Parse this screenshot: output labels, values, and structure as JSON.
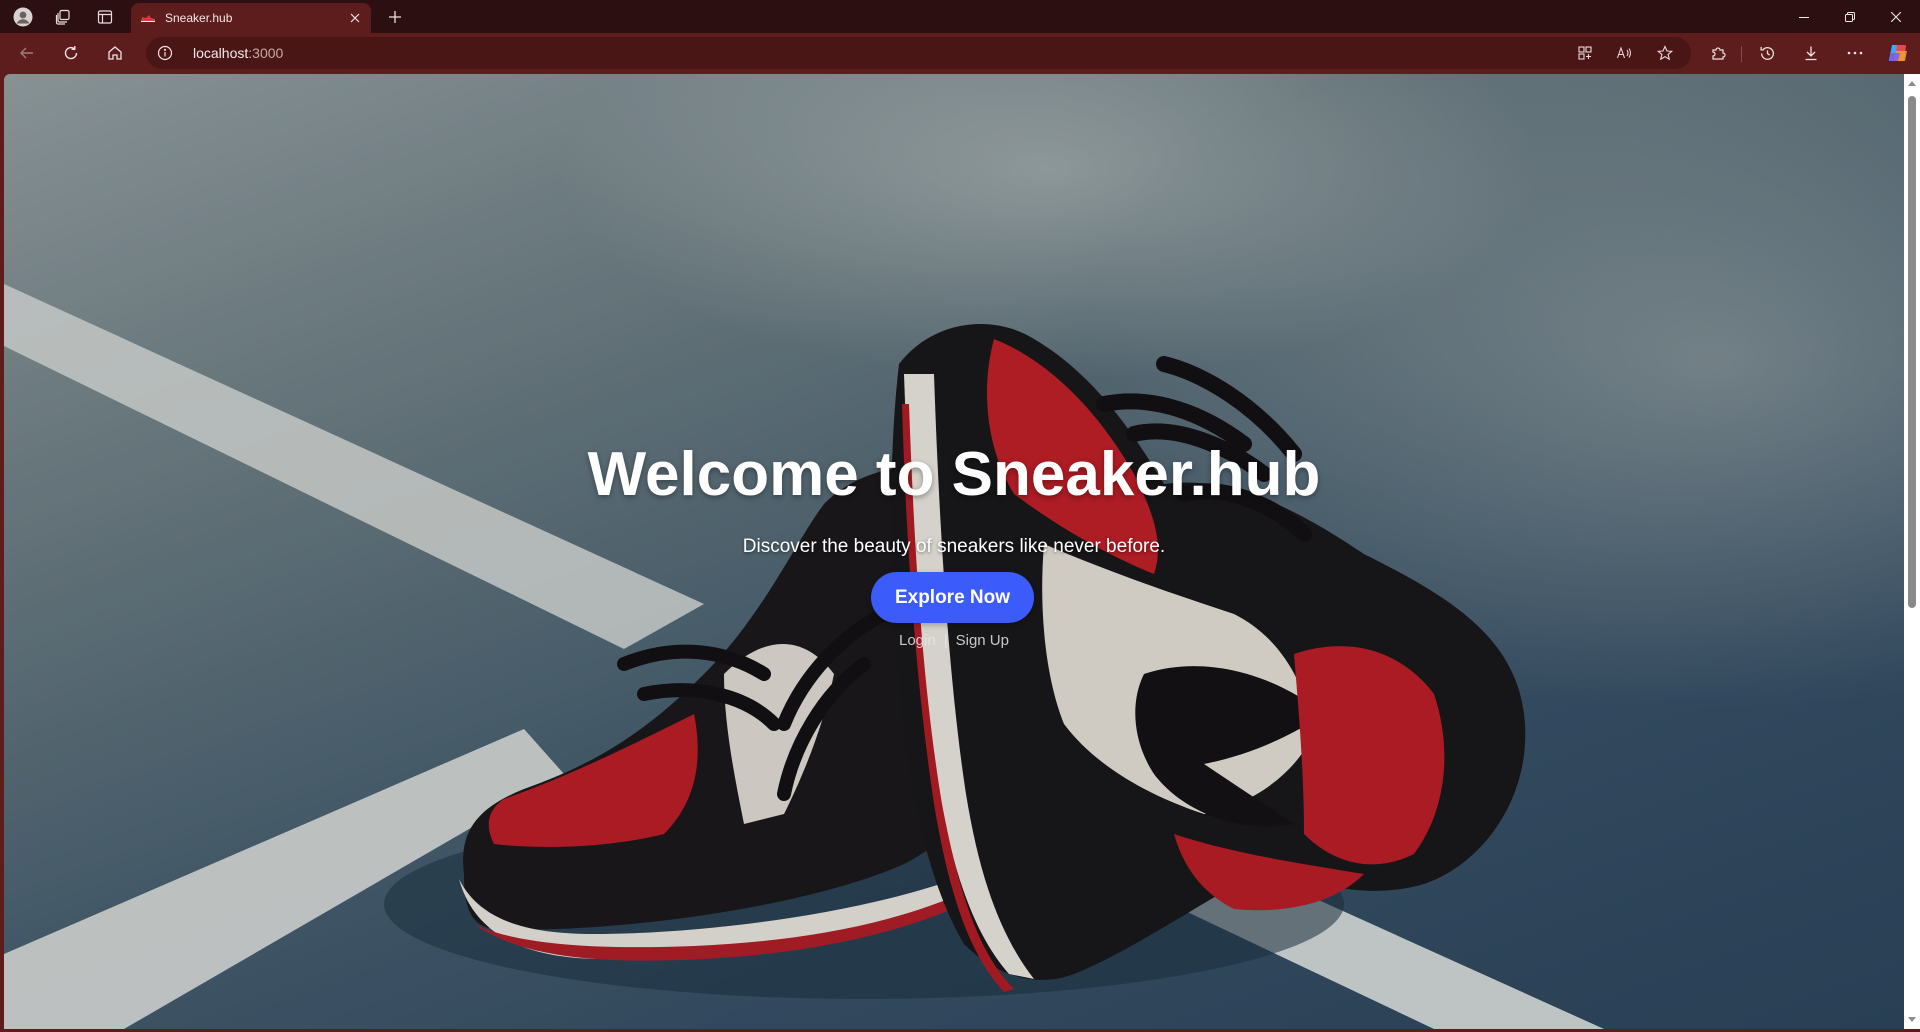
{
  "browser": {
    "tab_title": "Sneaker.hub",
    "url_host": "localhost",
    "url_port": ":3000",
    "colors": {
      "titlebar": "#2c1011",
      "toolbar": "#5d1d1d",
      "omnibox": "#4a1515"
    },
    "icons": {
      "profile": "profile-avatar-icon",
      "workspaces": "workspaces-icon",
      "tab_actions": "tab-actions-icon",
      "favicon": "sneaker-favicon-icon",
      "close_tab": "close-icon",
      "new_tab": "plus-icon",
      "back": "arrow-left-icon",
      "refresh": "refresh-icon",
      "home": "home-icon",
      "site_info": "info-icon",
      "app_available": "app-grid-icon",
      "read_aloud": "read-aloud-icon",
      "favorite": "star-icon",
      "extensions": "puzzle-icon",
      "history": "history-icon",
      "downloads": "download-icon",
      "menu": "more-dots-icon",
      "copilot": "copilot-icon",
      "minimize": "minimize-icon",
      "restore": "restore-icon",
      "close_window": "close-window-icon"
    }
  },
  "page": {
    "hero_title": "Welcome to Sneaker.hub",
    "hero_subtitle": "Discover the beauty of sneakers like never before.",
    "cta_label": "Explore Now",
    "login_label": "Login",
    "separator": "|",
    "signup_label": "Sign Up",
    "colors": {
      "cta": "#3b5bfb",
      "shoe_red": "#c8202a",
      "court_blue": "#3c5a73",
      "court_line": "#e8ecea"
    }
  }
}
